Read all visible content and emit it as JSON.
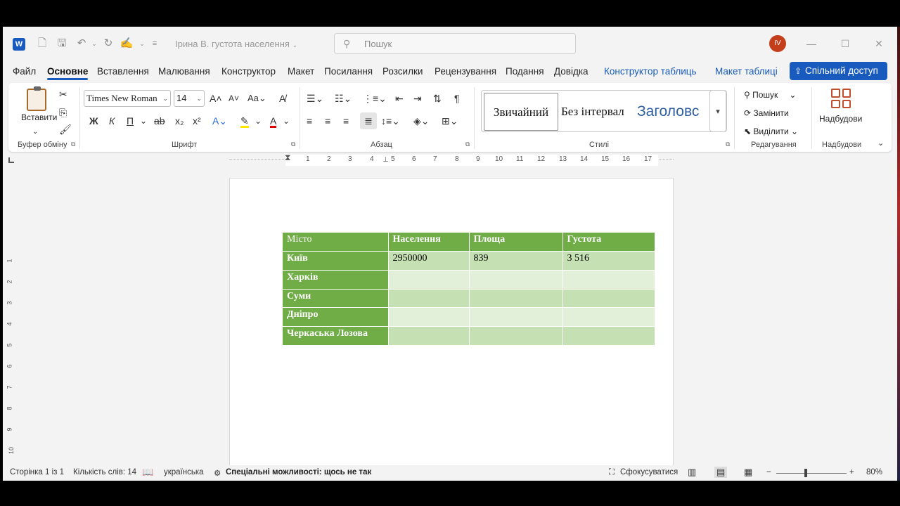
{
  "app": {
    "logo": "W",
    "title": "Ірина В. густота населення",
    "search_placeholder": "Пошук",
    "avatar": "IV"
  },
  "tabs": [
    "Файл",
    "Основне",
    "Вставлення",
    "Малювання",
    "Конструктор",
    "Макет",
    "Посилання",
    "Розсилки",
    "Рецензування",
    "Подання",
    "Довідка",
    "Конструктор таблиць",
    "Макет таблиці"
  ],
  "active_tab": "Основне",
  "share_label": "Спільний доступ",
  "ribbon": {
    "clipboard": {
      "paste": "Вставити",
      "group": "Буфер обміну"
    },
    "font": {
      "name": "Times New Roman",
      "size": "14",
      "group": "Шрифт",
      "bold": "Ж",
      "italic": "К",
      "underline": "П"
    },
    "paragraph": {
      "group": "Абзац"
    },
    "styles": {
      "group": "Стилі",
      "items": [
        "Звичайний",
        "Без інтервал",
        "Заголовс"
      ]
    },
    "editing": {
      "group": "Редагування",
      "find": "Пошук",
      "replace": "Замінити",
      "select": "Виділити"
    },
    "addins": {
      "label": "Надбудови",
      "group": "Надбудови"
    }
  },
  "ruler": {
    "h": [
      "1",
      "2",
      "3",
      "4",
      "5",
      "6",
      "7",
      "8",
      "9",
      "10",
      "11",
      "12",
      "13",
      "14",
      "15",
      "16",
      "17"
    ],
    "v": [
      "1",
      "2",
      "3",
      "4",
      "5",
      "6",
      "7",
      "8",
      "9",
      "10"
    ]
  },
  "table": {
    "header": [
      "Місто",
      "Населення",
      "Площа",
      "Густота"
    ],
    "rows": [
      {
        "city": "Київ",
        "cells": [
          "2950000",
          "839",
          "3 516"
        ]
      },
      {
        "city": "Харків",
        "cells": [
          "",
          "",
          ""
        ]
      },
      {
        "city": "Суми",
        "cells": [
          "",
          "",
          ""
        ]
      },
      {
        "city": "Дніпро",
        "cells": [
          "",
          "",
          ""
        ]
      },
      {
        "city": "Черкаська Лозова",
        "cells": [
          "",
          "",
          ""
        ]
      }
    ]
  },
  "status": {
    "page": "Сторінка 1 із 1",
    "words": "Кількість слів: 14",
    "language": "українська",
    "accessibility": "Спеціальні можливості: щось не так",
    "focus": "Сфокусуватися",
    "zoom": "80%"
  },
  "colors": {
    "accent": "#185abd",
    "table_header": "#70ad47",
    "band_dark": "#c5e0b3",
    "band_light": "#e2efd9"
  }
}
